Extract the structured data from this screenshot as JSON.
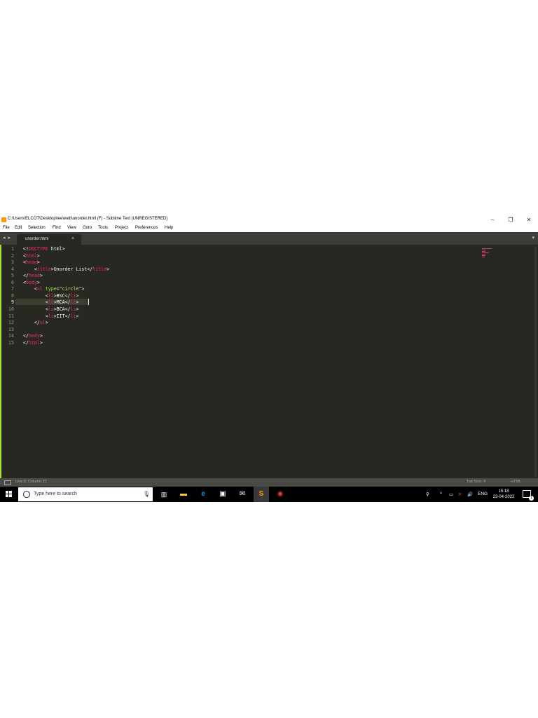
{
  "window": {
    "title": "C:\\Users\\ELCOT\\Desktop\\lee\\web\\unorder.html (F) - Sublime Text (UNREGISTERED)",
    "minimize": "–",
    "maximize": "❐",
    "close": "✕"
  },
  "menu": [
    "File",
    "Edit",
    "Selection",
    "Find",
    "View",
    "Goto",
    "Tools",
    "Project",
    "Preferences",
    "Help"
  ],
  "tabs": [
    {
      "label": "unorder.html",
      "close": "×"
    }
  ],
  "tabbar": {
    "nav_arrows": "◂ ▸",
    "dropdown": "▾"
  },
  "editor": {
    "line_numbers": [
      "1",
      "2",
      "3",
      "4",
      "5",
      "6",
      "7",
      "8",
      "9",
      "10",
      "11",
      "12",
      "13",
      "14",
      "15"
    ],
    "current_line": 9,
    "lines": [
      [
        {
          "t": "<!",
          "c": "ptxt"
        },
        {
          "t": "DOCTYPE",
          "c": "tag"
        },
        {
          "t": " html>",
          "c": "ptxt"
        }
      ],
      [
        {
          "t": "<",
          "c": "ptxt"
        },
        {
          "t": "html",
          "c": "tag"
        },
        {
          "t": ">",
          "c": "ptxt"
        }
      ],
      [
        {
          "t": "<",
          "c": "ptxt"
        },
        {
          "t": "head",
          "c": "tag"
        },
        {
          "t": ">",
          "c": "ptxt"
        }
      ],
      [
        {
          "t": "    <",
          "c": "ptxt"
        },
        {
          "t": "title",
          "c": "tag"
        },
        {
          "t": ">Unorder List</",
          "c": "ptxt"
        },
        {
          "t": "title",
          "c": "tag"
        },
        {
          "t": ">",
          "c": "ptxt"
        }
      ],
      [
        {
          "t": "</",
          "c": "ptxt"
        },
        {
          "t": "head",
          "c": "tag"
        },
        {
          "t": ">",
          "c": "ptxt"
        }
      ],
      [
        {
          "t": "<",
          "c": "ptxt"
        },
        {
          "t": "body",
          "c": "tag"
        },
        {
          "t": ">",
          "c": "ptxt"
        }
      ],
      [
        {
          "t": "    <",
          "c": "ptxt"
        },
        {
          "t": "ul",
          "c": "tag"
        },
        {
          "t": " ",
          "c": "ptxt"
        },
        {
          "t": "type",
          "c": "attr"
        },
        {
          "t": "=",
          "c": "ptxt"
        },
        {
          "t": "\"circle\"",
          "c": "str"
        },
        {
          "t": ">",
          "c": "ptxt"
        }
      ],
      [
        {
          "t": "        <",
          "c": "ptxt"
        },
        {
          "t": "li",
          "c": "tag"
        },
        {
          "t": ">BSC</",
          "c": "ptxt"
        },
        {
          "t": "li",
          "c": "tag"
        },
        {
          "t": ">",
          "c": "ptxt"
        }
      ],
      [
        {
          "t": "        <",
          "c": "ptxt"
        },
        {
          "t": "li",
          "c": "tag"
        },
        {
          "t": ">MCA</",
          "c": "ptxt"
        },
        {
          "t": "li",
          "c": "tag"
        },
        {
          "t": ">",
          "c": "ptxt"
        }
      ],
      [
        {
          "t": "        <",
          "c": "ptxt"
        },
        {
          "t": "li",
          "c": "tag"
        },
        {
          "t": ">BCA</",
          "c": "ptxt"
        },
        {
          "t": "li",
          "c": "tag"
        },
        {
          "t": ">",
          "c": "ptxt"
        }
      ],
      [
        {
          "t": "        <",
          "c": "ptxt"
        },
        {
          "t": "li",
          "c": "tag"
        },
        {
          "t": ">IIT</",
          "c": "ptxt"
        },
        {
          "t": "li",
          "c": "tag"
        },
        {
          "t": ">",
          "c": "ptxt"
        }
      ],
      [
        {
          "t": "    </",
          "c": "ptxt"
        },
        {
          "t": "ul",
          "c": "tag"
        },
        {
          "t": ">",
          "c": "ptxt"
        }
      ],
      [],
      [
        {
          "t": "</",
          "c": "ptxt"
        },
        {
          "t": "body",
          "c": "tag"
        },
        {
          "t": ">",
          "c": "ptxt"
        }
      ],
      [
        {
          "t": "</",
          "c": "ptxt"
        },
        {
          "t": "html",
          "c": "tag"
        },
        {
          "t": ">",
          "c": "ptxt"
        }
      ]
    ]
  },
  "statusbar": {
    "position": "Line 9, Column 31",
    "tab_size": "Tab Size: 4",
    "syntax": "HTML"
  },
  "taskbar": {
    "search_placeholder": "Type here to search",
    "apps": [
      "task-view-icon",
      "file-explorer-icon",
      "edge-icon",
      "store-icon",
      "mail-icon",
      "sublime-text-icon",
      "chrome-icon"
    ],
    "tray": {
      "language": "ENG",
      "time": "15:18",
      "date": "23-04-2022"
    }
  },
  "colors": {
    "editor_bg": "#272822",
    "tag": "#f92672",
    "attr": "#a6e22e",
    "string": "#e6db74",
    "text": "#f8f8f2",
    "line_number": "#8f908a"
  }
}
